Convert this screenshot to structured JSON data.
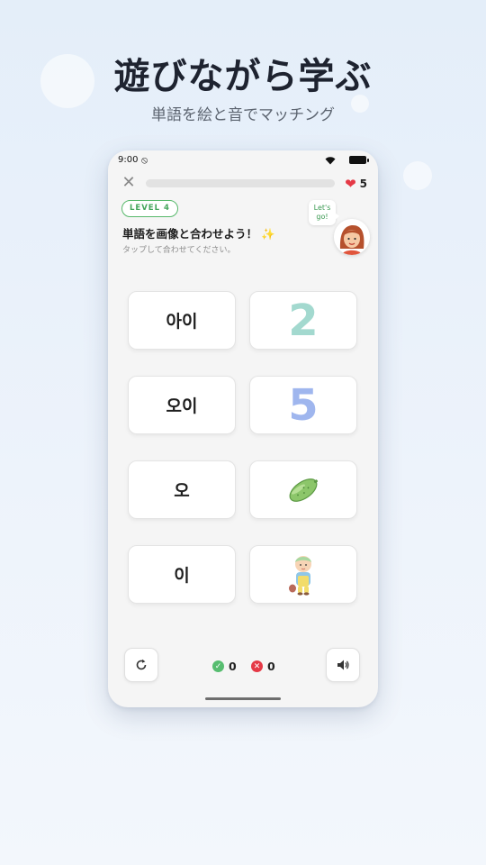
{
  "headline": "遊びながら学ぶ",
  "subline": "単語を絵と音でマッチング",
  "status_bar": {
    "time": "9:00",
    "vpn_icon": "shield-off-icon"
  },
  "top_bar": {
    "close_icon": "close-icon",
    "progress": 0.0,
    "hearts": "5",
    "heart_icon": "heart-icon"
  },
  "level_badge": "LEVEL 4",
  "instruction": "単語を画像と合わせよう！",
  "instruction_emoji": "✨",
  "sub_instruction": "タップして合わせてください。",
  "mascot": {
    "speech_line1": "Let's",
    "speech_line2": "go!"
  },
  "words": [
    "아이",
    "오이",
    "오",
    "이"
  ],
  "pictures": [
    {
      "type": "numeral",
      "text": "2",
      "color": "#a3d9cf",
      "icon": "number-two-icon"
    },
    {
      "type": "numeral",
      "text": "5",
      "color": "#9fb6ee",
      "icon": "number-five-icon"
    },
    {
      "type": "image",
      "icon": "cucumber-icon"
    },
    {
      "type": "image",
      "icon": "child-icon"
    }
  ],
  "footer": {
    "restart_icon": "restart-icon",
    "correct_count": "0",
    "wrong_count": "0",
    "sound_icon": "speaker-icon",
    "correct_color": "#57bd70",
    "wrong_color": "#e53946"
  }
}
